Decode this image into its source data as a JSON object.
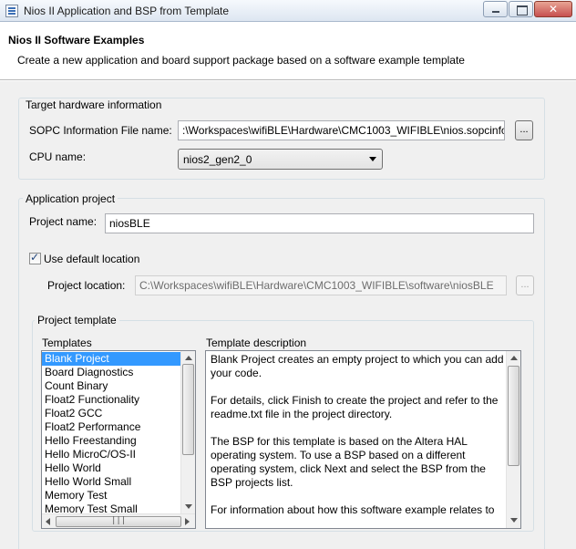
{
  "window": {
    "title": "Nios II Application and BSP from Template",
    "icon": "app-icon"
  },
  "header": {
    "title": "Nios II Software Examples",
    "description": "Create a new application and board support package based on a software example template"
  },
  "target_hardware": {
    "group_label": "Target hardware information",
    "sopc_label": "SOPC Information File name:",
    "sopc_value": ":\\Workspaces\\wifiBLE\\Hardware\\CMC1003_WIFIBLE\\nios.sopcinfo",
    "browse_label": "...",
    "cpu_label": "CPU name:",
    "cpu_value": "nios2_gen2_0"
  },
  "application_project": {
    "group_label": "Application project",
    "name_label": "Project name:",
    "name_value": "niosBLE",
    "default_location_label": "Use default location",
    "default_location_checked": true,
    "location_label": "Project location:",
    "location_value": "C:\\Workspaces\\wifiBLE\\Hardware\\CMC1003_WIFIBLE\\software\\niosBLE",
    "browse_label": "..."
  },
  "project_template": {
    "group_label": "Project template",
    "templates_label": "Templates",
    "description_label": "Template description",
    "templates": [
      "Blank Project",
      "Board Diagnostics",
      "Count Binary",
      "Float2 Functionality",
      "Float2 GCC",
      "Float2 Performance",
      "Hello Freestanding",
      "Hello MicroC/OS-II",
      "Hello World",
      "Hello World Small",
      "Memory Test",
      "Memory Test Small"
    ],
    "selected_template": "Blank Project",
    "description_paragraphs": [
      "Blank Project creates an empty project to which you can add your code.",
      "For details, click Finish to create the project and refer to the readme.txt file in the project directory.",
      "The BSP for this template is based on the Altera HAL operating system. To use a BSP based on a different operating system, click Next and select the BSP from the BSP projects list.",
      "For information about how this software example relates to"
    ]
  },
  "colors": {
    "selection": "#3399ff",
    "titlebar": "#dde6f1",
    "background": "#f0f0f0"
  }
}
